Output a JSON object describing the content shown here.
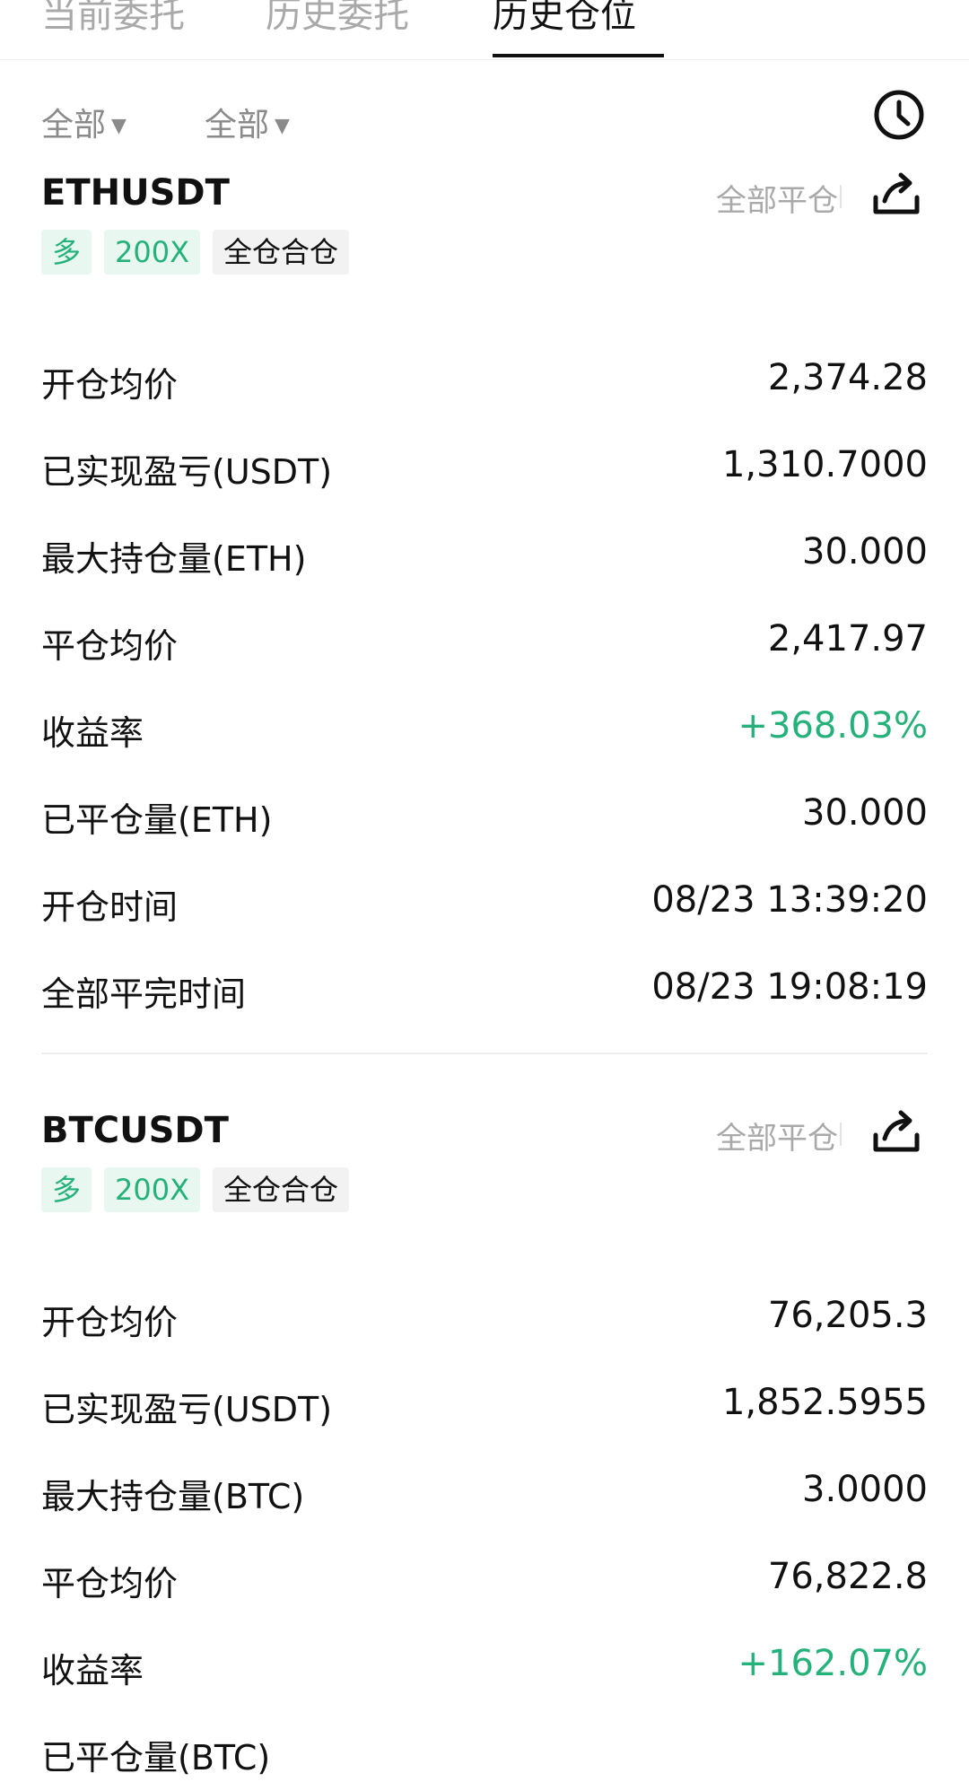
{
  "tabs": [
    {
      "label": "当前委托",
      "active": false
    },
    {
      "label": "历史委托",
      "active": false
    },
    {
      "label": "历史仓位",
      "active": true
    }
  ],
  "filters": {
    "first": "全部",
    "second": "全部"
  },
  "icons": {
    "history": "clock-icon",
    "share": "share-icon",
    "caret": "caret-down-icon"
  },
  "colors": {
    "positive": "#25b27a",
    "tag_bg": "#e8f7f0",
    "muted_text": "#a9a9a9"
  },
  "positions": [
    {
      "symbol": "ETHUSDT",
      "close_all": "全部平仓",
      "tags": [
        "多",
        "200X",
        "全仓合仓"
      ],
      "rows": [
        {
          "label": "开仓均价",
          "value": "2,374.28"
        },
        {
          "label": "已实现盈亏(USDT)",
          "value": "1,310.7000"
        },
        {
          "label": "最大持仓量(ETH)",
          "value": "30.000"
        },
        {
          "label": "平仓均价",
          "value": "2,417.97"
        },
        {
          "label": "收益率",
          "value": "+368.03%",
          "positive": true
        },
        {
          "label": "已平仓量(ETH)",
          "value": "30.000"
        },
        {
          "label": "开仓时间",
          "value": "08/23 13:39:20"
        },
        {
          "label": "全部平完时间",
          "value": "08/23 19:08:19"
        }
      ]
    },
    {
      "symbol": "BTCUSDT",
      "close_all": "全部平仓",
      "tags": [
        "多",
        "200X",
        "全仓合仓"
      ],
      "rows": [
        {
          "label": "开仓均价",
          "value": "76,205.3"
        },
        {
          "label": "已实现盈亏(USDT)",
          "value": "1,852.5955"
        },
        {
          "label": "最大持仓量(BTC)",
          "value": "3.0000"
        },
        {
          "label": "平仓均价",
          "value": "76,822.8"
        },
        {
          "label": "收益率",
          "value": "+162.07%",
          "positive": true
        },
        {
          "label": "已平仓量(BTC)",
          "value": ""
        }
      ]
    }
  ]
}
